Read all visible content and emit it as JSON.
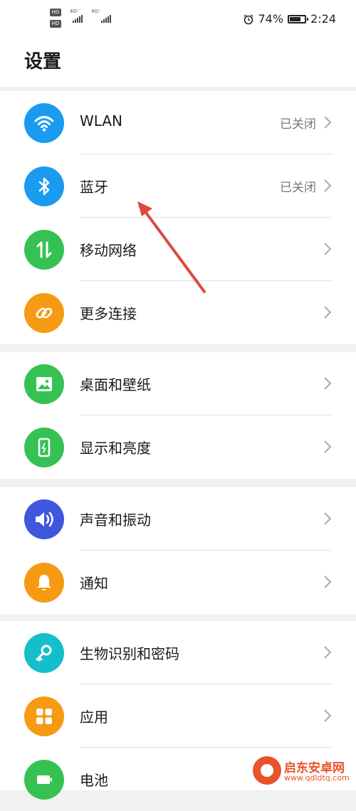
{
  "status_bar": {
    "hd": "HD",
    "net_a": "4G⁺",
    "net_b": "4G⁺",
    "alarm_icon": "alarm-clock-icon",
    "battery_percent_text": "74%",
    "battery_level": 0.74,
    "time": "2:24"
  },
  "header": {
    "title": "设置"
  },
  "groups": [
    {
      "items": [
        {
          "label": "WLAN",
          "status": "已关闭",
          "icon": "wifi-icon",
          "color": "#1a9bef"
        },
        {
          "label": "蓝牙",
          "status": "已关闭",
          "icon": "bluetooth-icon",
          "color": "#1a9bef"
        },
        {
          "label": "移动网络",
          "icon": "mobile-network-icon",
          "color": "#35c252"
        },
        {
          "label": "更多连接",
          "icon": "link-icon",
          "color": "#f59a12"
        }
      ]
    },
    {
      "items": [
        {
          "label": "桌面和壁纸",
          "icon": "wallpaper-icon",
          "color": "#35c252"
        },
        {
          "label": "显示和亮度",
          "icon": "display-icon",
          "color": "#35c252"
        }
      ]
    },
    {
      "items": [
        {
          "label": "声音和振动",
          "icon": "sound-icon",
          "color": "#3f57dd"
        },
        {
          "label": "通知",
          "icon": "bell-icon",
          "color": "#f59a12"
        }
      ]
    },
    {
      "items": [
        {
          "label": "生物识别和密码",
          "icon": "key-icon",
          "color": "#14bfcb"
        },
        {
          "label": "应用",
          "icon": "apps-grid-icon",
          "color": "#f59a12"
        },
        {
          "label": "电池",
          "icon": "battery-icon",
          "color": "#35c252"
        }
      ]
    }
  ],
  "annotation": {
    "arrow_color": "#e0473c"
  },
  "watermark": {
    "name": "启东安卓网",
    "url": "www.qdldtq.com",
    "color": "#e8532a"
  }
}
